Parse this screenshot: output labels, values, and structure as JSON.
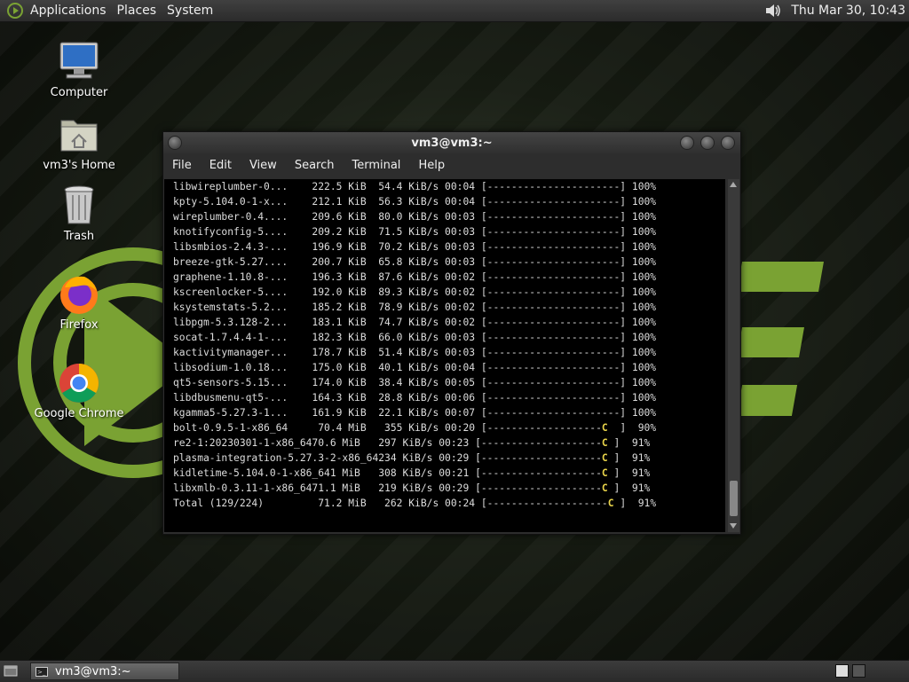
{
  "top_panel": {
    "menus": [
      "Applications",
      "Places",
      "System"
    ],
    "clock": "Thu Mar 30, 10:43",
    "icons": {
      "menu": "distro-logo-icon",
      "volume": "speaker-icon"
    }
  },
  "desktop": {
    "icons": [
      {
        "label": "Computer",
        "icon": "computer-icon"
      },
      {
        "label": "vm3's Home",
        "icon": "home-folder-icon"
      },
      {
        "label": "Trash",
        "icon": "trash-icon"
      },
      {
        "label": "Firefox",
        "icon": "firefox-icon"
      },
      {
        "label": "Google Chrome",
        "icon": "chrome-icon"
      }
    ]
  },
  "window": {
    "title": "vm3@vm3:~",
    "menu": [
      "File",
      "Edit",
      "View",
      "Search",
      "Terminal",
      "Help"
    ],
    "lines": [
      [
        "libwireplumber-0...    222.5 KiB  54.4 KiB/s 00:04 [----------------------] 100%",
        ""
      ],
      [
        "kpty-5.104.0-1-x...    212.1 KiB  56.3 KiB/s 00:04 [----------------------] 100%",
        ""
      ],
      [
        "wireplumber-0.4....    209.6 KiB  80.0 KiB/s 00:03 [----------------------] 100%",
        ""
      ],
      [
        "knotifyconfig-5....    209.2 KiB  71.5 KiB/s 00:03 [----------------------] 100%",
        ""
      ],
      [
        "libsmbios-2.4.3-...    196.9 KiB  70.2 KiB/s 00:03 [----------------------] 100%",
        ""
      ],
      [
        "breeze-gtk-5.27....    200.7 KiB  65.8 KiB/s 00:03 [----------------------] 100%",
        ""
      ],
      [
        "graphene-1.10.8-...    196.3 KiB  87.6 KiB/s 00:02 [----------------------] 100%",
        ""
      ],
      [
        "kscreenlocker-5....    192.0 KiB  89.3 KiB/s 00:02 [----------------------] 100%",
        ""
      ],
      [
        "ksystemstats-5.2...    185.2 KiB  78.9 KiB/s 00:02 [----------------------] 100%",
        ""
      ],
      [
        "libpgm-5.3.128-2...    183.1 KiB  74.7 KiB/s 00:02 [----------------------] 100%",
        ""
      ],
      [
        "socat-1.7.4.4-1-...    182.3 KiB  66.0 KiB/s 00:03 [----------------------] 100%",
        ""
      ],
      [
        "kactivitymanager...    178.7 KiB  51.4 KiB/s 00:03 [----------------------] 100%",
        ""
      ],
      [
        "libsodium-1.0.18...    175.0 KiB  40.1 KiB/s 00:04 [----------------------] 100%",
        ""
      ],
      [
        "qt5-sensors-5.15...    174.0 KiB  38.4 KiB/s 00:05 [----------------------] 100%",
        ""
      ],
      [
        "libdbusmenu-qt5-...    164.3 KiB  28.8 KiB/s 00:06 [----------------------] 100%",
        ""
      ],
      [
        "kgamma5-5.27.3-1...    161.9 KiB  22.1 KiB/s 00:07 [----------------------] 100%",
        ""
      ],
      [
        "bolt-0.9.5-1-x86_64     70.4 MiB   355 KiB/s 00:20 [-------------------",
        "C",
        "  ]  90%"
      ],
      [
        "re2-1:20230301-1-x86_6470.6 MiB   297 KiB/s 00:23 [--------------------",
        "C",
        " ]  91%"
      ],
      [
        "plasma-integration-5.27.3-2-x86_64234 KiB/s 00:29 [--------------------",
        "C",
        " ]  91%"
      ],
      [
        "kidletime-5.104.0-1-x86_641 MiB   308 KiB/s 00:21 [--------------------",
        "C",
        " ]  91%"
      ],
      [
        "libxmlb-0.3.11-1-x86_6471.1 MiB   219 KiB/s 00:29 [--------------------",
        "C",
        " ]  91%"
      ],
      [
        "Total (129/224)         71.2 MiB   262 KiB/s 00:24 [--------------------",
        "C",
        " ]  91%"
      ]
    ]
  },
  "taskbar": {
    "task_label": "vm3@vm3:~",
    "icons": {
      "show_desktop": "show-desktop-icon",
      "task": "terminal-icon"
    }
  },
  "colors": {
    "accent": "#7aa233",
    "progress_marker": "#e8d34a"
  }
}
